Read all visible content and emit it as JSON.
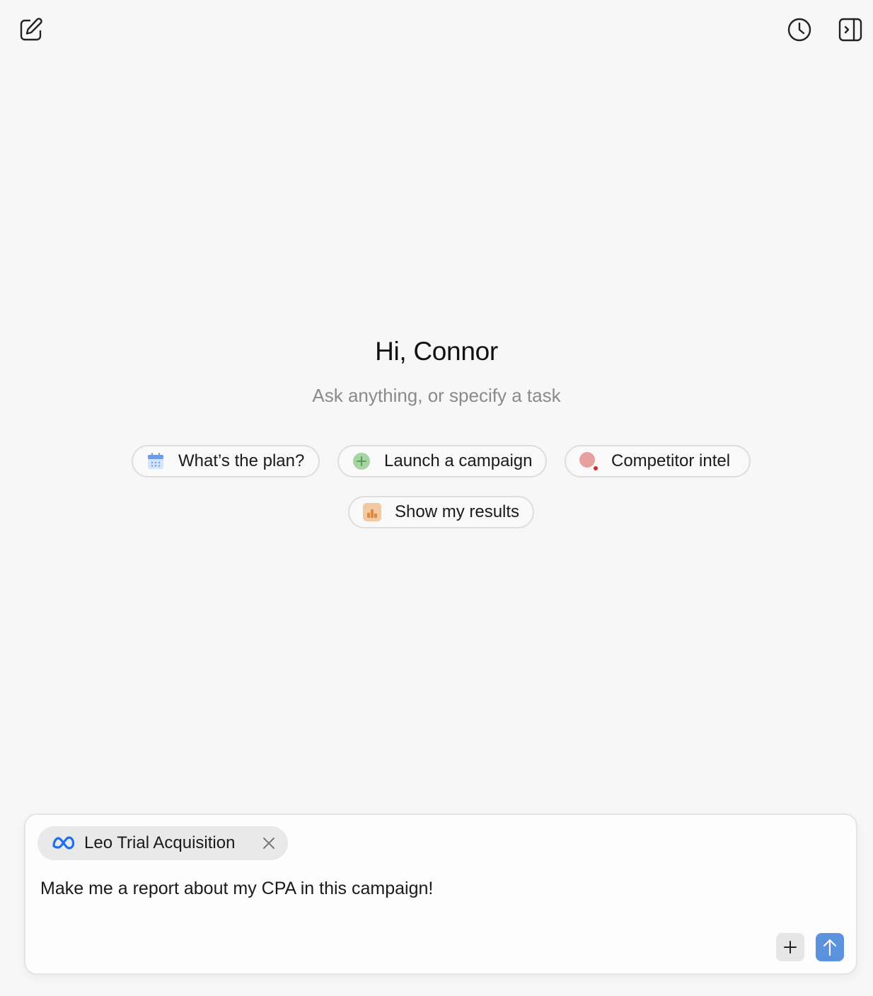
{
  "header": {
    "compose_icon": "compose-icon",
    "history_icon": "clock-icon",
    "panel_icon": "sidebar-toggle-icon"
  },
  "main": {
    "greeting": "Hi, Connor",
    "subtitle": "Ask anything, or specify a task"
  },
  "suggestions": [
    {
      "label": "What’s the plan?",
      "icon": "calendar-icon"
    },
    {
      "label": "Launch a campaign",
      "icon": "plus-circle-icon"
    },
    {
      "label": "Competitor intel",
      "icon": "record-dot-icon"
    },
    {
      "label": "Show my results",
      "icon": "bar-chart-icon"
    }
  ],
  "composer": {
    "context_tag": {
      "label": "Leo Trial Acquisition",
      "icon": "meta-logo-icon"
    },
    "text": "Make me a report about my CPA in this campaign!",
    "add_icon": "plus-icon",
    "send_icon": "arrow-up-icon"
  },
  "colors": {
    "background": "#f7f7f7",
    "send_button": "#5b92dd",
    "meta_blue": "#1f6ff2",
    "launch_green": "#a8d3a5",
    "intel_red": "#e6a0a0",
    "results_orange": "#f3c9a3"
  }
}
